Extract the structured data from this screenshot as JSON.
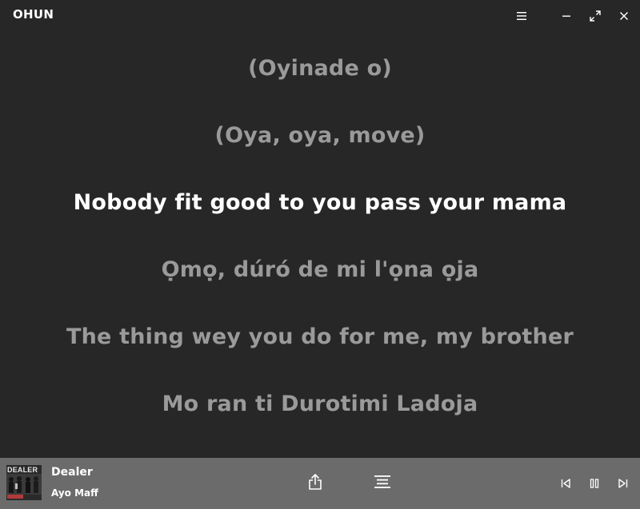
{
  "app": {
    "title": "OHUN"
  },
  "titlebar": {
    "icons": [
      "menu-icon",
      "minimize-icon",
      "fullscreen-icon",
      "close-icon"
    ]
  },
  "lyrics": {
    "lines": [
      "(Oyinade o)",
      "(Oya, oya, move)",
      "Nobody fit good to you pass your mama",
      "Ọmọ, dúró de mi l'ọna ọja",
      "The thing wey you do for me, my brother",
      "Mo ran ti Durotimi Ladoja"
    ],
    "active_index": 2
  },
  "player": {
    "cover_text": "DEALER",
    "track_title": "Dealer",
    "track_artist": "Ayo Maff",
    "icons": [
      "share-icon",
      "queue-icon",
      "previous-icon",
      "pause-icon",
      "next-icon"
    ]
  },
  "colors": {
    "background": "#272727",
    "player_bar": "#6b6b6b",
    "lyric_active": "#ffffff",
    "lyric_inactive": "#9a9a9a"
  }
}
